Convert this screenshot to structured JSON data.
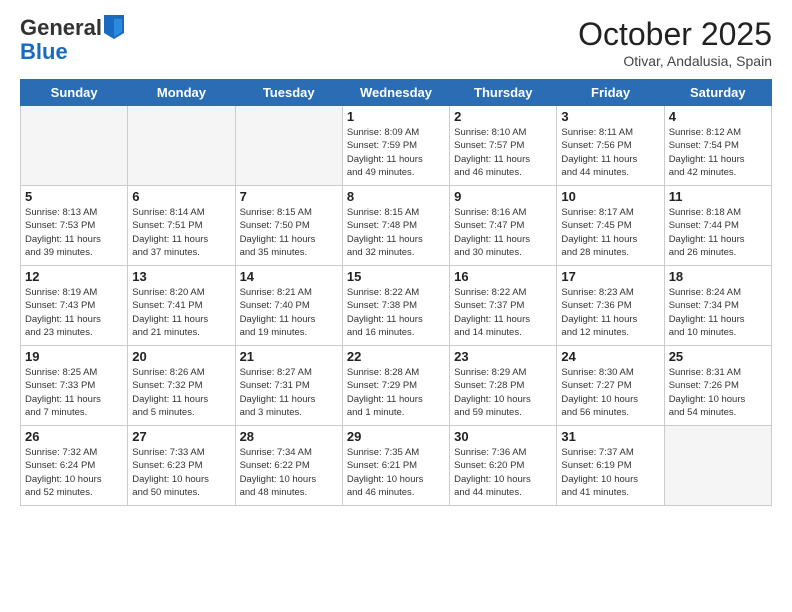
{
  "logo": {
    "general": "General",
    "blue": "Blue"
  },
  "title": "October 2025",
  "subtitle": "Otivar, Andalusia, Spain",
  "days_of_week": [
    "Sunday",
    "Monday",
    "Tuesday",
    "Wednesday",
    "Thursday",
    "Friday",
    "Saturday"
  ],
  "weeks": [
    [
      {
        "day": "",
        "info": ""
      },
      {
        "day": "",
        "info": ""
      },
      {
        "day": "",
        "info": ""
      },
      {
        "day": "1",
        "info": "Sunrise: 8:09 AM\nSunset: 7:59 PM\nDaylight: 11 hours\nand 49 minutes."
      },
      {
        "day": "2",
        "info": "Sunrise: 8:10 AM\nSunset: 7:57 PM\nDaylight: 11 hours\nand 46 minutes."
      },
      {
        "day": "3",
        "info": "Sunrise: 8:11 AM\nSunset: 7:56 PM\nDaylight: 11 hours\nand 44 minutes."
      },
      {
        "day": "4",
        "info": "Sunrise: 8:12 AM\nSunset: 7:54 PM\nDaylight: 11 hours\nand 42 minutes."
      }
    ],
    [
      {
        "day": "5",
        "info": "Sunrise: 8:13 AM\nSunset: 7:53 PM\nDaylight: 11 hours\nand 39 minutes."
      },
      {
        "day": "6",
        "info": "Sunrise: 8:14 AM\nSunset: 7:51 PM\nDaylight: 11 hours\nand 37 minutes."
      },
      {
        "day": "7",
        "info": "Sunrise: 8:15 AM\nSunset: 7:50 PM\nDaylight: 11 hours\nand 35 minutes."
      },
      {
        "day": "8",
        "info": "Sunrise: 8:15 AM\nSunset: 7:48 PM\nDaylight: 11 hours\nand 32 minutes."
      },
      {
        "day": "9",
        "info": "Sunrise: 8:16 AM\nSunset: 7:47 PM\nDaylight: 11 hours\nand 30 minutes."
      },
      {
        "day": "10",
        "info": "Sunrise: 8:17 AM\nSunset: 7:45 PM\nDaylight: 11 hours\nand 28 minutes."
      },
      {
        "day": "11",
        "info": "Sunrise: 8:18 AM\nSunset: 7:44 PM\nDaylight: 11 hours\nand 26 minutes."
      }
    ],
    [
      {
        "day": "12",
        "info": "Sunrise: 8:19 AM\nSunset: 7:43 PM\nDaylight: 11 hours\nand 23 minutes."
      },
      {
        "day": "13",
        "info": "Sunrise: 8:20 AM\nSunset: 7:41 PM\nDaylight: 11 hours\nand 21 minutes."
      },
      {
        "day": "14",
        "info": "Sunrise: 8:21 AM\nSunset: 7:40 PM\nDaylight: 11 hours\nand 19 minutes."
      },
      {
        "day": "15",
        "info": "Sunrise: 8:22 AM\nSunset: 7:38 PM\nDaylight: 11 hours\nand 16 minutes."
      },
      {
        "day": "16",
        "info": "Sunrise: 8:22 AM\nSunset: 7:37 PM\nDaylight: 11 hours\nand 14 minutes."
      },
      {
        "day": "17",
        "info": "Sunrise: 8:23 AM\nSunset: 7:36 PM\nDaylight: 11 hours\nand 12 minutes."
      },
      {
        "day": "18",
        "info": "Sunrise: 8:24 AM\nSunset: 7:34 PM\nDaylight: 11 hours\nand 10 minutes."
      }
    ],
    [
      {
        "day": "19",
        "info": "Sunrise: 8:25 AM\nSunset: 7:33 PM\nDaylight: 11 hours\nand 7 minutes."
      },
      {
        "day": "20",
        "info": "Sunrise: 8:26 AM\nSunset: 7:32 PM\nDaylight: 11 hours\nand 5 minutes."
      },
      {
        "day": "21",
        "info": "Sunrise: 8:27 AM\nSunset: 7:31 PM\nDaylight: 11 hours\nand 3 minutes."
      },
      {
        "day": "22",
        "info": "Sunrise: 8:28 AM\nSunset: 7:29 PM\nDaylight: 11 hours\nand 1 minute."
      },
      {
        "day": "23",
        "info": "Sunrise: 8:29 AM\nSunset: 7:28 PM\nDaylight: 10 hours\nand 59 minutes."
      },
      {
        "day": "24",
        "info": "Sunrise: 8:30 AM\nSunset: 7:27 PM\nDaylight: 10 hours\nand 56 minutes."
      },
      {
        "day": "25",
        "info": "Sunrise: 8:31 AM\nSunset: 7:26 PM\nDaylight: 10 hours\nand 54 minutes."
      }
    ],
    [
      {
        "day": "26",
        "info": "Sunrise: 7:32 AM\nSunset: 6:24 PM\nDaylight: 10 hours\nand 52 minutes."
      },
      {
        "day": "27",
        "info": "Sunrise: 7:33 AM\nSunset: 6:23 PM\nDaylight: 10 hours\nand 50 minutes."
      },
      {
        "day": "28",
        "info": "Sunrise: 7:34 AM\nSunset: 6:22 PM\nDaylight: 10 hours\nand 48 minutes."
      },
      {
        "day": "29",
        "info": "Sunrise: 7:35 AM\nSunset: 6:21 PM\nDaylight: 10 hours\nand 46 minutes."
      },
      {
        "day": "30",
        "info": "Sunrise: 7:36 AM\nSunset: 6:20 PM\nDaylight: 10 hours\nand 44 minutes."
      },
      {
        "day": "31",
        "info": "Sunrise: 7:37 AM\nSunset: 6:19 PM\nDaylight: 10 hours\nand 41 minutes."
      },
      {
        "day": "",
        "info": ""
      }
    ]
  ]
}
